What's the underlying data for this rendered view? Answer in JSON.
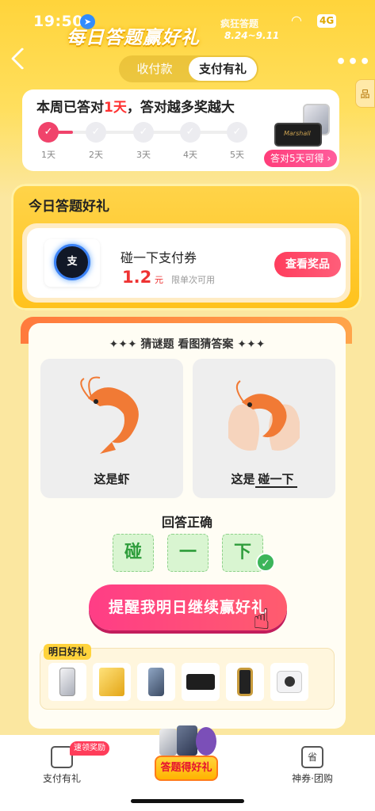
{
  "status": {
    "time": "19:50",
    "network": "4G"
  },
  "banner": {
    "title": "每日答题赢好礼",
    "tag": "疯狂答题",
    "date": "8.24~9.11"
  },
  "header": {
    "tabs": [
      "收付款",
      "支付有礼"
    ],
    "active_tab": "支付有礼",
    "side_tag": "品"
  },
  "week": {
    "title_prefix": "本周已答对",
    "days_count": "1天",
    "title_suffix": "，答对越多奖越大",
    "days": [
      "1天",
      "2天",
      "3天",
      "4天",
      "5天"
    ],
    "completed_days": 1,
    "prize_button": "答对5天可得 ›",
    "speaker_brand": "Marshall"
  },
  "gift": {
    "title": "今日答题好礼",
    "coupon_icon_text": "支",
    "coupon_name": "碰一下支付券",
    "amount": "1.2",
    "unit": "元",
    "limit": "限单次可用",
    "view_button": "查看奖品"
  },
  "quiz": {
    "heading": "✦✦✦ 猜谜题 看图猜答案 ✦✦✦",
    "left_label": "这是虾",
    "right_label_prefix": "这是",
    "right_label_answer": "碰一下",
    "result": "回答正确",
    "tiles": [
      "碰",
      "一",
      "下"
    ],
    "remind_button": "提醒我明日继续赢好礼"
  },
  "tomorrow": {
    "label": "明日好礼",
    "items": [
      "phone-silver",
      "gold-bar",
      "phone-blue",
      "speaker",
      "smart-watch",
      "instant-camera"
    ]
  },
  "nav": {
    "left_label": "支付有礼",
    "left_badge": "速领奖励",
    "center_label": "答题得好礼",
    "right_label": "神券·团购",
    "right_icon_text": "省"
  },
  "colors": {
    "accent": "#ff3d6b",
    "banner_yellow": "#ffd43b",
    "success_green": "#3cb55a"
  }
}
